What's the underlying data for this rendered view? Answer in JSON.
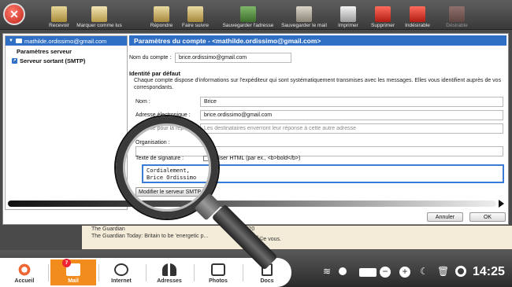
{
  "toolbar": {
    "items": [
      {
        "label": "Recevoir",
        "icon": "receive-icon"
      },
      {
        "label": "Marquer comme lus",
        "icon": "mark-read-icon"
      },
      {
        "label": "Répondre",
        "icon": "reply-icon"
      },
      {
        "label": "Faire suivre",
        "icon": "forward-icon"
      },
      {
        "label": "Sauvegarder l'adresse",
        "icon": "save-address-icon"
      },
      {
        "label": "Sauvegarder le mail",
        "icon": "save-mail-icon"
      },
      {
        "label": "Imprimer",
        "icon": "print-icon"
      },
      {
        "label": "Supprimer",
        "icon": "delete-icon"
      },
      {
        "label": "Indésirable",
        "icon": "spam-icon"
      },
      {
        "label": "Désirable",
        "icon": "not-spam-icon"
      }
    ]
  },
  "sidebar": {
    "account": "mathilde.ordissimo@gmail.com",
    "server_params": "Paramètres serveur",
    "smtp": "Serveur sortant (SMTP)"
  },
  "settings": {
    "title": "Paramètres du compte - <mathilde.ordissimo@gmail.com>",
    "account_name_label": "Nom du compte :",
    "account_name_value": "brice.ordissimo@gmail.com",
    "identity_title": "Identité par défaut",
    "identity_desc": "Chaque compte dispose d'informations sur l'expéditeur qui sont systématiquement transmises avec les messages. Elles vous identifient auprès de vos correspondants.",
    "name_label": "Nom :",
    "name_value": "Brice",
    "email_label": "Adresse électronique :",
    "email_value": "brice.ordissimo@gmail.com",
    "reply_label": "Adresse pour la réponse :",
    "reply_placeholder": "Les destinataires enverront leur réponse à cette autre adresse",
    "org_label": "Organisation :",
    "org_value": "",
    "signature_label": "Texte de signature :",
    "html_checkbox_label": "Utiliser HTML (par ex., <b>bold</b>)",
    "signature_line1": "Cordialement,",
    "signature_line2": "Brice Ordissimo",
    "smtp_button": "Modifier le serveur SMTP...",
    "cancel_button": "Annuler",
    "ok_button": "OK"
  },
  "maillist": {
    "row1_sender": "The Guardian",
    "row1_date": "24/06/20",
    "row2_subject": "The Guardian Today: Britain to be 'energetic p...",
    "row2_extra": "journÃ©e   vous."
  },
  "dock": {
    "items": [
      {
        "label": "Accueil",
        "icon": "home-icon"
      },
      {
        "label": "Mail",
        "icon": "mail-icon"
      },
      {
        "label": "Internet",
        "icon": "globe-icon"
      },
      {
        "label": "Adresses",
        "icon": "contacts-icon"
      },
      {
        "label": "Photos",
        "icon": "camera-icon"
      },
      {
        "label": "Docs",
        "icon": "docs-icon"
      }
    ],
    "mail_badge": "7",
    "clock": "14:25"
  },
  "colors": {
    "accent_blue": "#2f6fc4",
    "dock_active": "#f28c1c"
  }
}
